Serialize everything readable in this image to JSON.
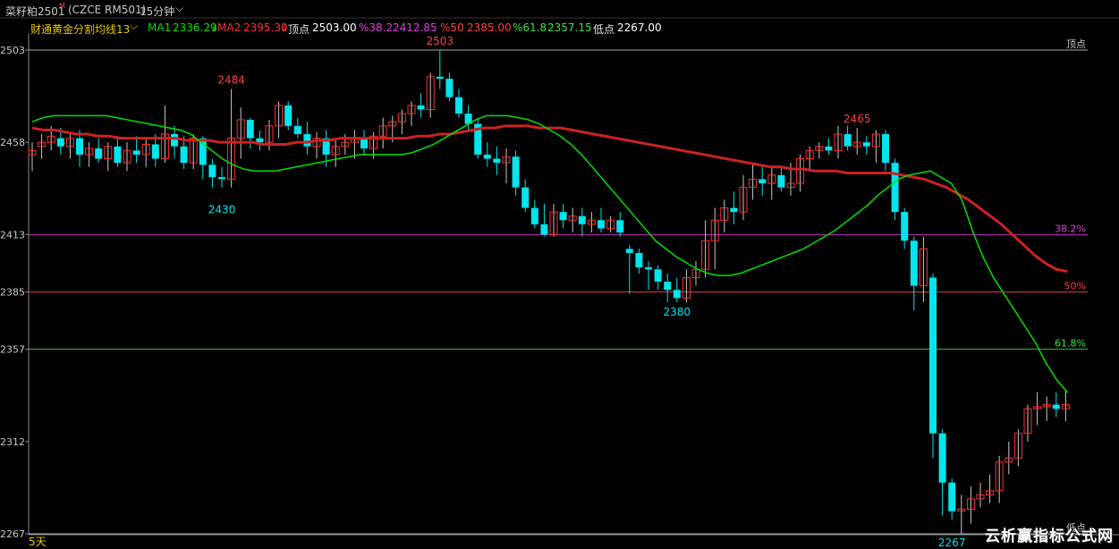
{
  "header": {
    "symbol": "菜籽粕2501",
    "symbol_sup": "M",
    "contract": "(CZCE RM501)",
    "period": "15分钟",
    "period_chevron": "chevron-down-icon"
  },
  "indicator": {
    "name": "财通黄金分割均线13",
    "ma1_label": "MA1",
    "ma1_value": "2336.29",
    "ma2_label": "MA2",
    "ma2_value": "2395.30",
    "top_label": "顶点",
    "top_value": "2503.00",
    "f382_label": "%38.2",
    "f382_value": "2412.85",
    "f50_label": "%50",
    "f50_value": "2385.00",
    "f618_label": "%61.8",
    "f618_value": "2357.15",
    "low_label": "低点",
    "low_value": "2267.00",
    "colors": {
      "ma1": "#00e000",
      "ma2": "#cc2222",
      "f382": "#e040e0",
      "f50": "#ff4040",
      "f618": "#40e040",
      "up": "#ff3030",
      "down": "#00e5ee"
    }
  },
  "bottom": {
    "period_label": "5天",
    "watermark": "云析赢指标公式网"
  },
  "chart_data": {
    "type": "candlestick",
    "y_ticks": [
      "2503",
      "2458",
      "2413",
      "2385",
      "2357",
      "2312",
      "2267"
    ],
    "ylim": [
      2265,
      2507
    ],
    "levels": [
      {
        "label": "顶点",
        "value": 2503,
        "color": "#c8c8c8"
      },
      {
        "label": "38.2%",
        "value": 2412.85,
        "color": "#e040e0"
      },
      {
        "label": "50%",
        "value": 2385,
        "color": "#ff4040"
      },
      {
        "label": "61.8%",
        "value": 2357.15,
        "color": "#40e040"
      },
      {
        "label": "低点",
        "value": 2267,
        "color": "#c8c8c8"
      }
    ],
    "annotations": [
      {
        "text": "2503",
        "index": 43,
        "value": 2503,
        "kind": "high"
      },
      {
        "text": "2484",
        "index": 21,
        "value": 2484,
        "kind": "high"
      },
      {
        "text": "2430",
        "index": 20,
        "value": 2430,
        "kind": "low"
      },
      {
        "text": "2465",
        "index": 87,
        "value": 2465,
        "kind": "high"
      },
      {
        "text": "2380",
        "index": 68,
        "value": 2380,
        "kind": "low"
      },
      {
        "text": "2267",
        "index": 97,
        "value": 2267,
        "kind": "low"
      }
    ],
    "ohlc": [
      [
        2452,
        2458,
        2444,
        2454
      ],
      [
        2456,
        2462,
        2450,
        2458
      ],
      [
        2458,
        2466,
        2454,
        2461
      ],
      [
        2460,
        2465,
        2452,
        2456
      ],
      [
        2456,
        2463,
        2450,
        2460
      ],
      [
        2460,
        2464,
        2446,
        2452
      ],
      [
        2452,
        2458,
        2446,
        2455
      ],
      [
        2455,
        2460,
        2448,
        2450
      ],
      [
        2450,
        2458,
        2444,
        2456
      ],
      [
        2456,
        2461,
        2446,
        2448
      ],
      [
        2448,
        2458,
        2444,
        2454
      ],
      [
        2454,
        2461,
        2448,
        2452
      ],
      [
        2452,
        2460,
        2446,
        2457
      ],
      [
        2457,
        2462,
        2446,
        2450
      ],
      [
        2450,
        2476,
        2448,
        2462
      ],
      [
        2462,
        2466,
        2450,
        2456
      ],
      [
        2456,
        2461,
        2445,
        2448
      ],
      [
        2448,
        2462,
        2445,
        2460
      ],
      [
        2460,
        2461,
        2440,
        2447
      ],
      [
        2447,
        2450,
        2436,
        2441
      ],
      [
        2441,
        2446,
        2436,
        2440
      ],
      [
        2440,
        2484,
        2436,
        2460
      ],
      [
        2460,
        2475,
        2450,
        2469
      ],
      [
        2469,
        2470,
        2455,
        2460
      ],
      [
        2460,
        2464,
        2454,
        2458
      ],
      [
        2458,
        2469,
        2454,
        2466
      ],
      [
        2466,
        2478,
        2460,
        2476
      ],
      [
        2476,
        2478,
        2464,
        2466
      ],
      [
        2466,
        2470,
        2460,
        2462
      ],
      [
        2462,
        2468,
        2452,
        2456
      ],
      [
        2456,
        2463,
        2450,
        2460
      ],
      [
        2460,
        2464,
        2446,
        2452
      ],
      [
        2452,
        2460,
        2446,
        2456
      ],
      [
        2456,
        2462,
        2452,
        2458
      ],
      [
        2458,
        2464,
        2450,
        2460
      ],
      [
        2460,
        2464,
        2452,
        2455
      ],
      [
        2455,
        2463,
        2450,
        2461
      ],
      [
        2461,
        2470,
        2455,
        2466
      ],
      [
        2466,
        2471,
        2458,
        2468
      ],
      [
        2468,
        2474,
        2462,
        2472
      ],
      [
        2472,
        2478,
        2466,
        2476
      ],
      [
        2476,
        2482,
        2470,
        2474
      ],
      [
        2474,
        2492,
        2470,
        2490
      ],
      [
        2490,
        2503,
        2484,
        2489
      ],
      [
        2489,
        2492,
        2478,
        2480
      ],
      [
        2480,
        2484,
        2470,
        2472
      ],
      [
        2472,
        2476,
        2464,
        2467
      ],
      [
        2467,
        2470,
        2450,
        2452
      ],
      [
        2452,
        2458,
        2446,
        2450
      ],
      [
        2450,
        2456,
        2442,
        2448
      ],
      [
        2448,
        2455,
        2438,
        2451
      ],
      [
        2451,
        2454,
        2432,
        2436
      ],
      [
        2436,
        2440,
        2424,
        2426
      ],
      [
        2426,
        2430,
        2416,
        2418
      ],
      [
        2418,
        2428,
        2412,
        2413
      ],
      [
        2413,
        2428,
        2412,
        2424
      ],
      [
        2424,
        2428,
        2416,
        2420
      ],
      [
        2420,
        2426,
        2414,
        2422
      ],
      [
        2422,
        2426,
        2412,
        2418
      ],
      [
        2418,
        2424,
        2414,
        2420
      ],
      [
        2420,
        2426,
        2414,
        2416
      ],
      [
        2416,
        2422,
        2414,
        2420
      ],
      [
        2420,
        2424,
        2412,
        2414
      ],
      [
        2406,
        2408,
        2384,
        2404
      ],
      [
        2404,
        2406,
        2394,
        2397
      ],
      [
        2397,
        2400,
        2386,
        2396
      ],
      [
        2396,
        2398,
        2386,
        2390
      ],
      [
        2390,
        2394,
        2380,
        2386
      ],
      [
        2386,
        2392,
        2380,
        2382
      ],
      [
        2382,
        2396,
        2380,
        2392
      ],
      [
        2392,
        2400,
        2388,
        2396
      ],
      [
        2396,
        2420,
        2392,
        2410
      ],
      [
        2410,
        2426,
        2396,
        2420
      ],
      [
        2420,
        2430,
        2414,
        2426
      ],
      [
        2426,
        2434,
        2418,
        2424
      ],
      [
        2424,
        2442,
        2420,
        2436
      ],
      [
        2436,
        2448,
        2430,
        2440
      ],
      [
        2440,
        2446,
        2432,
        2438
      ],
      [
        2438,
        2446,
        2430,
        2442
      ],
      [
        2442,
        2446,
        2434,
        2436
      ],
      [
        2436,
        2448,
        2432,
        2438
      ],
      [
        2438,
        2452,
        2434,
        2450
      ],
      [
        2450,
        2456,
        2444,
        2454
      ],
      [
        2454,
        2458,
        2450,
        2456
      ],
      [
        2456,
        2460,
        2452,
        2454
      ],
      [
        2454,
        2466,
        2450,
        2462
      ],
      [
        2462,
        2466,
        2454,
        2456
      ],
      [
        2456,
        2465,
        2452,
        2458
      ],
      [
        2458,
        2461,
        2452,
        2456
      ],
      [
        2456,
        2464,
        2448,
        2462
      ],
      [
        2462,
        2464,
        2444,
        2448
      ],
      [
        2448,
        2450,
        2420,
        2424
      ],
      [
        2424,
        2426,
        2406,
        2410
      ],
      [
        2410,
        2412,
        2376,
        2388
      ],
      [
        2388,
        2412,
        2380,
        2406
      ],
      [
        2392,
        2394,
        2304,
        2316
      ],
      [
        2316,
        2318,
        2276,
        2292
      ],
      [
        2292,
        2294,
        2274,
        2278
      ],
      [
        2278,
        2286,
        2267,
        2279
      ],
      [
        2279,
        2290,
        2272,
        2284
      ],
      [
        2284,
        2292,
        2280,
        2286
      ],
      [
        2286,
        2296,
        2282,
        2288
      ],
      [
        2288,
        2305,
        2282,
        2302
      ],
      [
        2302,
        2312,
        2296,
        2304
      ],
      [
        2304,
        2318,
        2300,
        2316
      ],
      [
        2316,
        2330,
        2312,
        2328
      ],
      [
        2328,
        2336,
        2320,
        2329
      ],
      [
        2329,
        2334,
        2322,
        2330
      ],
      [
        2330,
        2336,
        2324,
        2328
      ],
      [
        2328,
        2337,
        2322,
        2330
      ]
    ],
    "ma1": [
      2468,
      2470,
      2471,
      2471,
      2471,
      2471,
      2471,
      2471,
      2470,
      2469,
      2468,
      2467,
      2466,
      2465,
      2464,
      2462,
      2458,
      2454,
      2450,
      2447,
      2445,
      2444,
      2444,
      2444,
      2445,
      2446,
      2447,
      2448,
      2449,
      2450,
      2451,
      2452,
      2452,
      2452,
      2452,
      2452,
      2453,
      2455,
      2457,
      2460,
      2463,
      2466,
      2469,
      2471,
      2471,
      2471,
      2470,
      2469,
      2467,
      2464,
      2461,
      2457,
      2452,
      2446,
      2440,
      2434,
      2428,
      2422,
      2416,
      2410,
      2406,
      2402,
      2399,
      2396,
      2394,
      2393,
      2393,
      2394,
      2396,
      2398,
      2400,
      2402,
      2404,
      2406,
      2409,
      2412,
      2415,
      2419,
      2423,
      2427,
      2432,
      2436,
      2440,
      2442,
      2443,
      2444,
      2441,
      2438,
      2430,
      2415,
      2402,
      2392,
      2384,
      2376,
      2368,
      2360,
      2350,
      2342,
      2336
    ],
    "ma2": [
      2465,
      2464,
      2464,
      2463,
      2462,
      2462,
      2461,
      2461,
      2460,
      2460,
      2460,
      2460,
      2460,
      2460,
      2459,
      2459,
      2459,
      2458,
      2458,
      2458,
      2458,
      2457,
      2457,
      2457,
      2458,
      2458,
      2459,
      2459,
      2460,
      2460,
      2460,
      2460,
      2460,
      2460,
      2460,
      2461,
      2461,
      2462,
      2462,
      2463,
      2464,
      2465,
      2465,
      2466,
      2466,
      2466,
      2465,
      2465,
      2465,
      2464,
      2463,
      2462,
      2461,
      2460,
      2459,
      2458,
      2457,
      2456,
      2455,
      2454,
      2453,
      2452,
      2451,
      2450,
      2449,
      2448,
      2447,
      2446,
      2446,
      2445,
      2445,
      2444,
      2444,
      2444,
      2443,
      2443,
      2443,
      2443,
      2443,
      2442,
      2441,
      2440,
      2438,
      2436,
      2433,
      2430,
      2426,
      2422,
      2418,
      2413,
      2408,
      2403,
      2399,
      2396,
      2395
    ]
  }
}
